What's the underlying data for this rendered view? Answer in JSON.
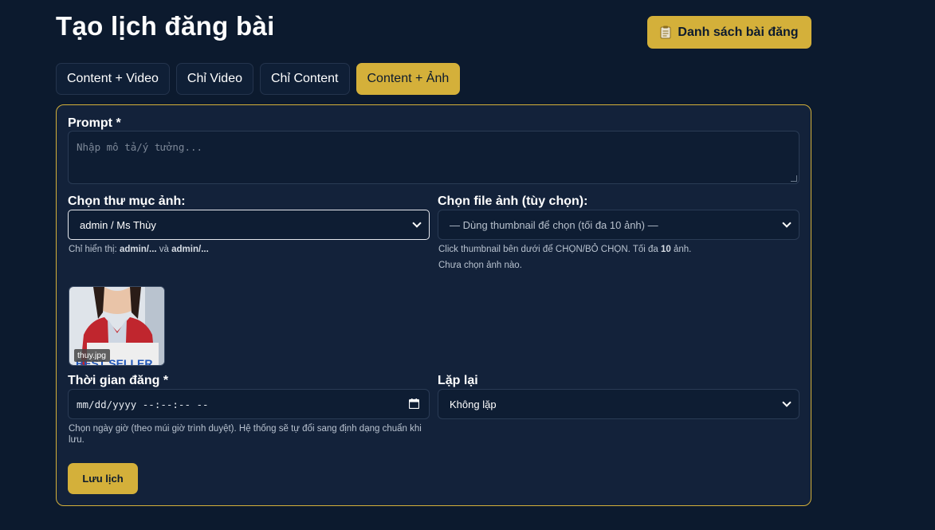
{
  "header": {
    "title": "Tạo lịch đăng bài",
    "list_button_label": "Danh sách bài đăng",
    "list_button_icon": "clipboard-icon"
  },
  "tabs": [
    {
      "label": "Content + Video",
      "active": false
    },
    {
      "label": "Chỉ Video",
      "active": false
    },
    {
      "label": "Chỉ Content",
      "active": false
    },
    {
      "label": "Content + Ảnh",
      "active": true
    }
  ],
  "form": {
    "prompt": {
      "label": "Prompt *",
      "placeholder": "Nhập mô tả/ý tưởng...",
      "value": ""
    },
    "folder": {
      "label": "Chọn thư mục ảnh:",
      "selected": "admin / Ms Thùy",
      "help_prefix": "Chỉ hiển thị: ",
      "help_bold1": "admin/...",
      "help_mid": " và ",
      "help_bold2": "admin/..."
    },
    "image_file": {
      "label": "Chọn file ảnh (tùy chọn):",
      "selected": "— Dùng thumbnail để chọn (tối đa 10 ảnh) —",
      "help_prefix": "Click thumbnail bên dưới để CHỌN/BỎ CHỌN. Tối đa ",
      "help_bold": "10",
      "help_suffix": " ảnh.",
      "status": "Chưa chọn ảnh nào."
    },
    "thumbnails": [
      {
        "filename": "thuy.jpg",
        "overlay_text": "BEST SELLER"
      }
    ],
    "post_time": {
      "label": "Thời gian đăng *",
      "placeholder": "mm/dd/yyyy --:--:-- --",
      "help": "Chọn ngày giờ (theo múi giờ trình duyệt). Hệ thống sẽ tự đổi sang định dạng chuẩn khi lưu."
    },
    "repeat": {
      "label": "Lặp lại",
      "selected": "Không lặp"
    },
    "save_label": "Lưu lịch"
  },
  "colors": {
    "background": "#0c1a2e",
    "panel": "#13223a",
    "accent": "#d4b03a",
    "input_bg": "#0e1d33"
  }
}
